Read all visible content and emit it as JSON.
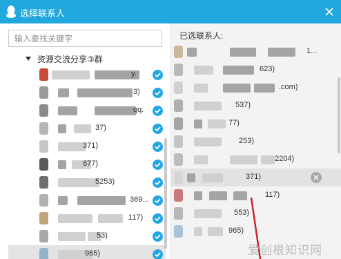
{
  "window": {
    "title": "选择联系人",
    "accent": "#21a9df",
    "logo_icon": "qq-penguin-icon",
    "close_icon": "close-icon"
  },
  "search": {
    "placeholder": "输入查找关键字",
    "icon": "search-icon"
  },
  "left": {
    "group": {
      "name": "资源交流分享③群",
      "expanded": true,
      "icon": "caret-down-icon"
    },
    "contacts": [
      {
        "text": "y.",
        "checked": true,
        "avatar_color": "#c94a3b",
        "selected": false
      },
      {
        "text": "3)",
        "checked": true,
        "avatar_color": "#9a9a9a",
        "selected": false
      },
      {
        "text": "qq.",
        "checked": true,
        "avatar_color": "#8a8a8a",
        "selected": false
      },
      {
        "text": "37)",
        "checked": true,
        "avatar_color": "#b5b5b5",
        "selected": false
      },
      {
        "text": "371)",
        "checked": true,
        "avatar_color": "#c7c7c7",
        "selected": false
      },
      {
        "text": "677)",
        "checked": true,
        "avatar_color": "#5a5a5a",
        "selected": false
      },
      {
        "text": "5253)",
        "checked": true,
        "avatar_color": "#6e6e6e",
        "selected": false
      },
      {
        "text": "369...",
        "checked": true,
        "avatar_color": "#b0b0b0",
        "selected": false
      },
      {
        "text": "117)",
        "checked": true,
        "avatar_color": "#c2a57a",
        "selected": false
      },
      {
        "text": "53)",
        "checked": true,
        "avatar_color": "#a9a9a9",
        "selected": false
      },
      {
        "text": "965)",
        "checked": true,
        "avatar_color": "#8fb3c7",
        "selected": true
      }
    ]
  },
  "right": {
    "label": "已选联系人:",
    "contacts": [
      {
        "text": "1...",
        "avatar_color": "#c9b89a",
        "hover": false
      },
      {
        "text": "623)",
        "avatar_color": "#b9b9b9",
        "hover": false
      },
      {
        "text": ".com)",
        "avatar_color": "#d0d0d0",
        "hover": false
      },
      {
        "text": "537)",
        "avatar_color": "#b0b0b0",
        "hover": false
      },
      {
        "text": "77)",
        "avatar_color": "#a5a5a5",
        "hover": false
      },
      {
        "text": "253)",
        "avatar_color": "#c4c4c4",
        "hover": false
      },
      {
        "text": "2204)",
        "avatar_color": "#bcbcbc",
        "hover": false
      },
      {
        "text": "371)",
        "avatar_color": "#d6d6d6",
        "hover": true
      },
      {
        "text": "117)",
        "avatar_color": "#c97b7b",
        "hover": false
      },
      {
        "text": "553)",
        "avatar_color": "#b7b7b7",
        "hover": false
      },
      {
        "text": "965)",
        "avatar_color": "#a8c4d6",
        "hover": false
      }
    ],
    "remove_icon": "remove-x-icon"
  },
  "check_icon": "checkmark-icon",
  "check_color": "#22a7e2",
  "watermark": "爱创根知识网"
}
